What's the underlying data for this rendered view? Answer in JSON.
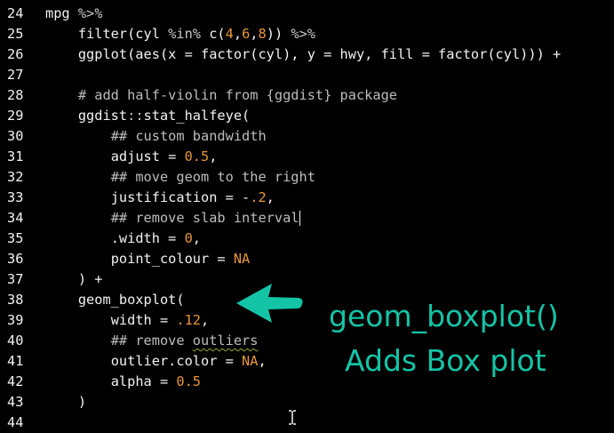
{
  "editor": {
    "lines": [
      {
        "n": "24",
        "indent": "",
        "tokens": [
          [
            "kw",
            "mpg "
          ],
          [
            "op",
            "%>%"
          ]
        ]
      },
      {
        "n": "25",
        "indent": "    ",
        "tokens": [
          [
            "kw",
            "filter(cyl "
          ],
          [
            "op",
            "%in%"
          ],
          [
            "kw",
            " c("
          ],
          [
            "num",
            "4"
          ],
          [
            "kw",
            ","
          ],
          [
            "num",
            "6"
          ],
          [
            "kw",
            ","
          ],
          [
            "num",
            "8"
          ],
          [
            "kw",
            ")) "
          ],
          [
            "op",
            "%>%"
          ]
        ]
      },
      {
        "n": "26",
        "indent": "    ",
        "tokens": [
          [
            "kw",
            "ggplot(aes(x = factor(cyl), y = hwy, fill = factor(cyl))) +"
          ]
        ]
      },
      {
        "n": "27",
        "indent": "",
        "tokens": []
      },
      {
        "n": "28",
        "indent": "    ",
        "tokens": [
          [
            "cm",
            "# add half-violin from {ggdist} package"
          ]
        ]
      },
      {
        "n": "29",
        "indent": "    ",
        "tokens": [
          [
            "kw",
            "ggdist"
          ],
          [
            "op",
            "::"
          ],
          [
            "kw",
            "stat_halfeye("
          ]
        ]
      },
      {
        "n": "30",
        "indent": "        ",
        "tokens": [
          [
            "cm",
            "## custom bandwidth"
          ]
        ]
      },
      {
        "n": "31",
        "indent": "        ",
        "tokens": [
          [
            "kw",
            "adjust = "
          ],
          [
            "num",
            "0.5"
          ],
          [
            "kw",
            ","
          ]
        ]
      },
      {
        "n": "32",
        "indent": "        ",
        "tokens": [
          [
            "cm",
            "## move geom to the right"
          ]
        ]
      },
      {
        "n": "33",
        "indent": "        ",
        "tokens": [
          [
            "kw",
            "justification = -"
          ],
          [
            "num",
            ".2"
          ],
          [
            "kw",
            ","
          ]
        ]
      },
      {
        "n": "34",
        "indent": "        ",
        "tokens": [
          [
            "cm",
            "## remove slab interval"
          ],
          [
            "cursor",
            ""
          ]
        ]
      },
      {
        "n": "35",
        "indent": "        ",
        "tokens": [
          [
            "kw",
            ".width = "
          ],
          [
            "num",
            "0"
          ],
          [
            "kw",
            ","
          ]
        ]
      },
      {
        "n": "36",
        "indent": "        ",
        "tokens": [
          [
            "kw",
            "point_colour = "
          ],
          [
            "na",
            "NA"
          ]
        ]
      },
      {
        "n": "37",
        "indent": "    ",
        "tokens": [
          [
            "kw",
            ") +"
          ]
        ]
      },
      {
        "n": "38",
        "indent": "    ",
        "tokens": [
          [
            "kw",
            "geom_boxplot("
          ]
        ]
      },
      {
        "n": "39",
        "indent": "        ",
        "tokens": [
          [
            "kw",
            "width = "
          ],
          [
            "num",
            ".12"
          ],
          [
            "kw",
            ","
          ]
        ]
      },
      {
        "n": "40",
        "indent": "        ",
        "tokens": [
          [
            "cm",
            "## remove "
          ],
          [
            "sq",
            "outliers"
          ]
        ]
      },
      {
        "n": "41",
        "indent": "        ",
        "tokens": [
          [
            "kw",
            "outlier.color = "
          ],
          [
            "na",
            "NA"
          ],
          [
            "kw",
            ","
          ]
        ]
      },
      {
        "n": "42",
        "indent": "        ",
        "tokens": [
          [
            "kw",
            "alpha = "
          ],
          [
            "num",
            "0.5"
          ]
        ]
      },
      {
        "n": "43",
        "indent": "    ",
        "tokens": [
          [
            "kw",
            ")"
          ]
        ]
      },
      {
        "n": "44",
        "indent": "",
        "tokens": []
      }
    ]
  },
  "annotation": {
    "line1": "geom_boxplot()",
    "line2": "Adds Box plot",
    "color": "#14c4a6"
  },
  "icons": {
    "arrow": "left-arrow-icon",
    "cursor": "text-cursor-icon"
  }
}
